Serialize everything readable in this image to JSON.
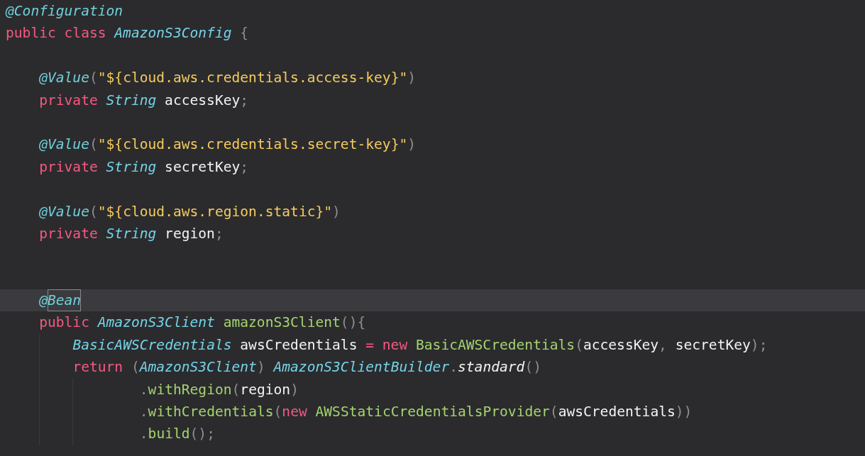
{
  "editor": {
    "lines": [
      {
        "tokens": [
          {
            "t": "@Configuration",
            "kind": "annotation"
          }
        ]
      },
      {
        "tokens": [
          {
            "t": "public",
            "kind": "keyword",
            "space_after": true
          },
          {
            "t": "class",
            "kind": "keyword",
            "space_after": true
          },
          {
            "t": "AmazonS3Config",
            "kind": "type",
            "space_after": true
          },
          {
            "t": "{",
            "kind": "punct"
          }
        ],
        "children": [
          {
            "kind": "blank"
          },
          {
            "kind": "code",
            "tokens": [
              {
                "t": "@Value",
                "kind": "annotation"
              },
              {
                "t": "(",
                "kind": "punct"
              },
              {
                "t": "\"${cloud.aws.credentials.access-key}\"",
                "kind": "string"
              },
              {
                "t": ")",
                "kind": "punct"
              }
            ]
          },
          {
            "kind": "code",
            "tokens": [
              {
                "t": "private",
                "kind": "keyword",
                "space_after": true
              },
              {
                "t": "String",
                "kind": "type",
                "space_after": true
              },
              {
                "t": "accessKey",
                "kind": "plain"
              },
              {
                "t": ";",
                "kind": "punct"
              }
            ]
          },
          {
            "kind": "blank"
          },
          {
            "kind": "code",
            "tokens": [
              {
                "t": "@Value",
                "kind": "annotation"
              },
              {
                "t": "(",
                "kind": "punct"
              },
              {
                "t": "\"${cloud.aws.credentials.secret-key}\"",
                "kind": "string"
              },
              {
                "t": ")",
                "kind": "punct"
              }
            ]
          },
          {
            "kind": "code",
            "tokens": [
              {
                "t": "private",
                "kind": "keyword",
                "space_after": true
              },
              {
                "t": "String",
                "kind": "type",
                "space_after": true
              },
              {
                "t": "secretKey",
                "kind": "plain"
              },
              {
                "t": ";",
                "kind": "punct"
              }
            ]
          },
          {
            "kind": "blank"
          },
          {
            "kind": "code",
            "tokens": [
              {
                "t": "@Value",
                "kind": "annotation"
              },
              {
                "t": "(",
                "kind": "punct"
              },
              {
                "t": "\"${cloud.aws.region.static}\"",
                "kind": "string"
              },
              {
                "t": ")",
                "kind": "punct"
              }
            ]
          },
          {
            "kind": "code",
            "tokens": [
              {
                "t": "private",
                "kind": "keyword",
                "space_after": true
              },
              {
                "t": "String",
                "kind": "type",
                "space_after": true
              },
              {
                "t": "region",
                "kind": "plain"
              },
              {
                "t": ";",
                "kind": "punct"
              }
            ]
          },
          {
            "kind": "blank"
          },
          {
            "kind": "blank"
          },
          {
            "kind": "code",
            "current": true,
            "tokens": [
              {
                "t": "@",
                "kind": "annotation"
              },
              {
                "t": "Bean",
                "kind": "annotation",
                "boxed": true
              }
            ]
          },
          {
            "kind": "code",
            "tokens": [
              {
                "t": "public",
                "kind": "keyword",
                "space_after": true
              },
              {
                "t": "AmazonS3Client",
                "kind": "type",
                "space_after": true
              },
              {
                "t": "amazonS3Client",
                "kind": "method"
              },
              {
                "t": "(){",
                "kind": "punct"
              }
            ],
            "children": [
              {
                "tokens": [
                  {
                    "t": "BasicAWSCredentials",
                    "kind": "type",
                    "space_after": true
                  },
                  {
                    "t": "awsCredentials",
                    "kind": "plain",
                    "space_after": true
                  },
                  {
                    "t": "=",
                    "kind": "keyword",
                    "space_after": true
                  },
                  {
                    "t": "new",
                    "kind": "keyword",
                    "space_after": true
                  },
                  {
                    "t": "BasicAWSCredentials",
                    "kind": "method"
                  },
                  {
                    "t": "(",
                    "kind": "punct"
                  },
                  {
                    "t": "accessKey",
                    "kind": "plain"
                  },
                  {
                    "t": ",",
                    "kind": "punct",
                    "space_after": true
                  },
                  {
                    "t": "secretKey",
                    "kind": "plain"
                  },
                  {
                    "t": ");",
                    "kind": "punct"
                  }
                ]
              },
              {
                "tokens": [
                  {
                    "t": "return",
                    "kind": "keyword",
                    "space_after": true
                  },
                  {
                    "t": "(",
                    "kind": "punct"
                  },
                  {
                    "t": "AmazonS3Client",
                    "kind": "type"
                  },
                  {
                    "t": ")",
                    "kind": "punct",
                    "space_after": true
                  },
                  {
                    "t": "AmazonS3ClientBuilder",
                    "kind": "type"
                  },
                  {
                    "t": ".",
                    "kind": "punct"
                  },
                  {
                    "t": "standard",
                    "kind": "static"
                  },
                  {
                    "t": "()",
                    "kind": "punct"
                  }
                ],
                "children": [
                  {
                    "kind": "chained",
                    "tokens": [
                      {
                        "t": ".",
                        "kind": "punct"
                      },
                      {
                        "t": "withRegion",
                        "kind": "method"
                      },
                      {
                        "t": "(",
                        "kind": "punct"
                      },
                      {
                        "t": "region",
                        "kind": "plain"
                      },
                      {
                        "t": ")",
                        "kind": "punct"
                      }
                    ]
                  },
                  {
                    "kind": "chained",
                    "tokens": [
                      {
                        "t": ".",
                        "kind": "punct"
                      },
                      {
                        "t": "withCredentials",
                        "kind": "method"
                      },
                      {
                        "t": "(",
                        "kind": "punct"
                      },
                      {
                        "t": "new",
                        "kind": "keyword",
                        "space_after": true
                      },
                      {
                        "t": "AWSStaticCredentialsProvider",
                        "kind": "method"
                      },
                      {
                        "t": "(",
                        "kind": "punct"
                      },
                      {
                        "t": "awsCredentials",
                        "kind": "plain"
                      },
                      {
                        "t": "))",
                        "kind": "punct"
                      }
                    ]
                  },
                  {
                    "kind": "chained",
                    "tokens": [
                      {
                        "t": ".",
                        "kind": "punct"
                      },
                      {
                        "t": "build",
                        "kind": "method"
                      },
                      {
                        "t": "();",
                        "kind": "punct"
                      }
                    ]
                  }
                ]
              }
            ]
          }
        ]
      }
    ]
  }
}
